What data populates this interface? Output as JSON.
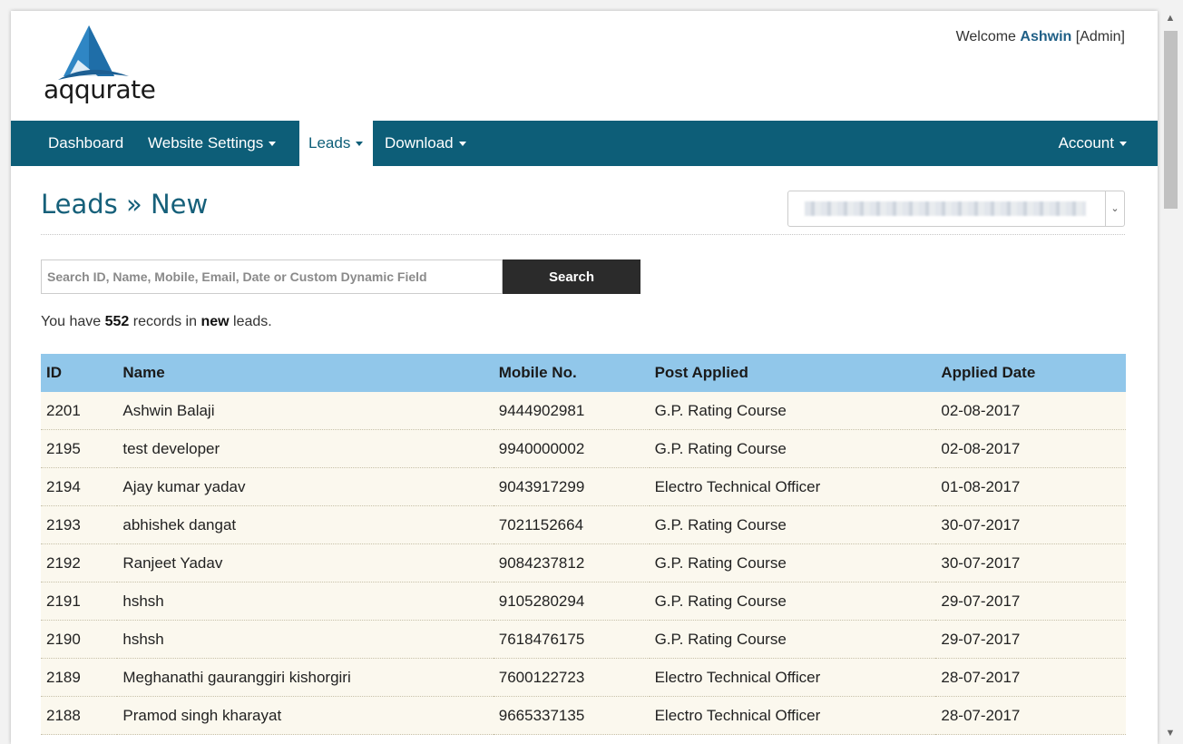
{
  "header": {
    "logo_text": "aqqurate",
    "welcome_prefix": "Welcome",
    "welcome_user": "Ashwin",
    "welcome_role": "[Admin]"
  },
  "nav": {
    "dashboard": "Dashboard",
    "website_settings": "Website Settings",
    "leads": "Leads",
    "download": "Download",
    "account": "Account"
  },
  "page": {
    "title": "Leads » New"
  },
  "search": {
    "placeholder": "Search ID, Name, Mobile, Email, Date or Custom Dynamic Field",
    "button_label": "Search"
  },
  "summary": {
    "prefix": "You have",
    "count": "552",
    "middle": "records in",
    "category": "new",
    "suffix": "leads."
  },
  "table": {
    "headers": [
      "ID",
      "Name",
      "Mobile No.",
      "Post Applied",
      "Applied Date"
    ],
    "rows": [
      {
        "id": "2201",
        "name": "Ashwin Balaji",
        "mobile": "9444902981",
        "post": "G.P. Rating Course",
        "date": "02-08-2017"
      },
      {
        "id": "2195",
        "name": "test developer",
        "mobile": "9940000002",
        "post": "G.P. Rating Course",
        "date": "02-08-2017"
      },
      {
        "id": "2194",
        "name": "Ajay kumar yadav",
        "mobile": "9043917299",
        "post": "Electro Technical Officer",
        "date": "01-08-2017"
      },
      {
        "id": "2193",
        "name": "abhishek dangat",
        "mobile": "7021152664",
        "post": "G.P. Rating Course",
        "date": "30-07-2017"
      },
      {
        "id": "2192",
        "name": "Ranjeet Yadav",
        "mobile": "9084237812",
        "post": "G.P. Rating Course",
        "date": "30-07-2017"
      },
      {
        "id": "2191",
        "name": "hshsh",
        "mobile": "9105280294",
        "post": "G.P. Rating Course",
        "date": "29-07-2017"
      },
      {
        "id": "2190",
        "name": "hshsh",
        "mobile": "7618476175",
        "post": "G.P. Rating Course",
        "date": "29-07-2017"
      },
      {
        "id": "2189",
        "name": "Meghanathi gauranggiri kishorgiri",
        "mobile": "7600122723",
        "post": "Electro Technical Officer",
        "date": "28-07-2017"
      },
      {
        "id": "2188",
        "name": "Pramod singh kharayat",
        "mobile": "9665337135",
        "post": "Electro Technical Officer",
        "date": "28-07-2017"
      }
    ]
  },
  "colors": {
    "nav_bg": "#0d5e78",
    "header_row_bg": "#91c7ea",
    "row_bg": "#fbf8ee",
    "title_color": "#16607a",
    "search_button_bg": "#2b2b2b"
  }
}
